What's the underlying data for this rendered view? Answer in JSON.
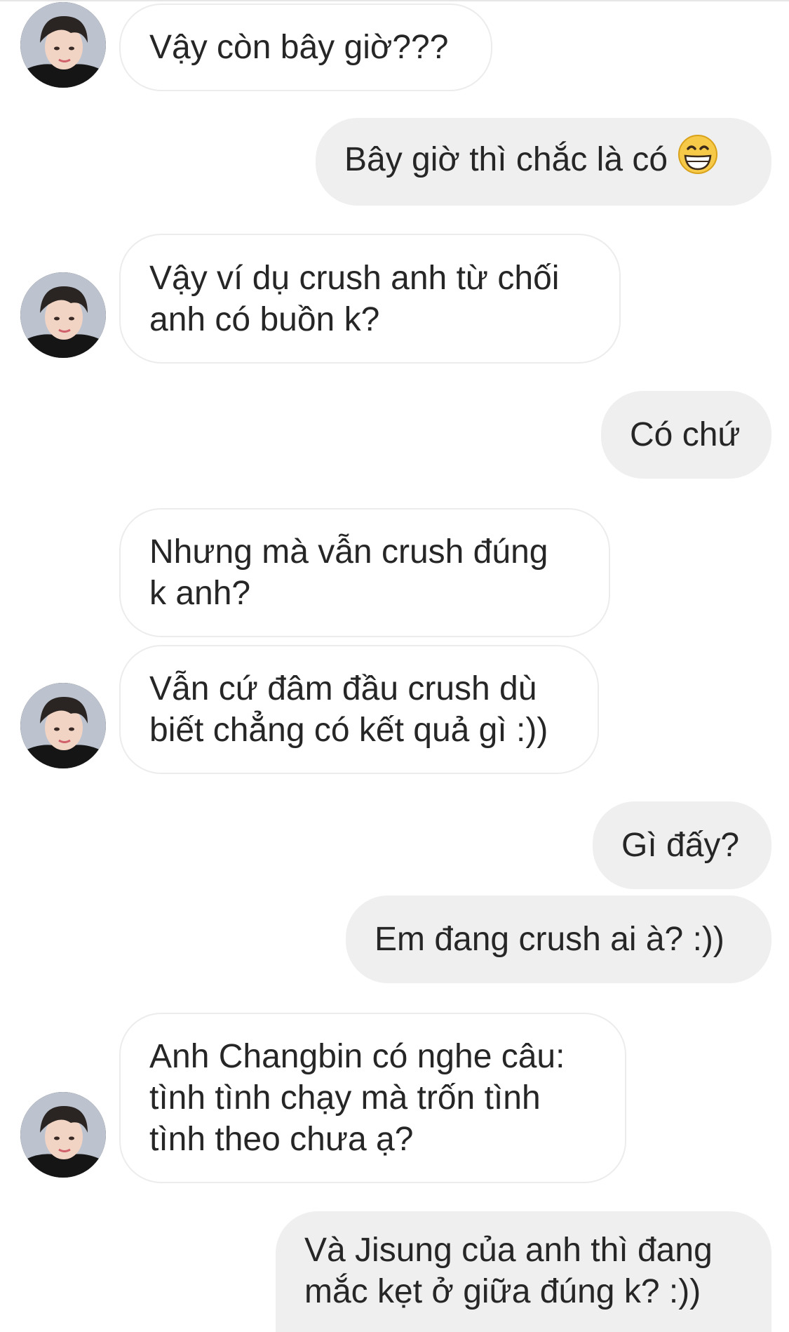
{
  "conversation": {
    "messages": [
      {
        "from": "them",
        "lines": [
          "Vậy còn bây giờ???"
        ]
      },
      {
        "from": "me",
        "lines": [
          "Bây giờ thì chắc là có"
        ],
        "emoji": "grinning-face-emoji"
      },
      {
        "from": "them",
        "lines": [
          "Vậy ví dụ crush anh từ chối",
          "anh có buồn k?"
        ]
      },
      {
        "from": "me",
        "lines": [
          "Có chứ"
        ]
      },
      {
        "from": "them",
        "lines": [
          "Nhưng mà vẫn crush đúng",
          "k anh?"
        ]
      },
      {
        "from": "them",
        "lines": [
          "Vẫn cứ đâm đầu crush dù",
          "biết chẳng có kết quả gì :))"
        ]
      },
      {
        "from": "me",
        "lines": [
          "Gì đấy?"
        ]
      },
      {
        "from": "me",
        "lines": [
          "Em đang crush ai à? :))"
        ]
      },
      {
        "from": "them",
        "lines": [
          "Anh Changbin có nghe câu:",
          "tình tình chạy mà trốn tình",
          "tình theo chưa ạ?"
        ]
      },
      {
        "from": "me",
        "lines": [
          "Và Jisung của anh thì đang",
          "mắc kẹt ở giữa đúng k? :))"
        ]
      }
    ]
  },
  "colors": {
    "incoming_bubble_bg": "#ffffff",
    "incoming_bubble_border": "#ececec",
    "outgoing_bubble_bg": "#efefef",
    "text": "#262626",
    "emoji_face": "#f7c948"
  },
  "icons": {
    "avatar": "profile-photo",
    "emoji": "grinning-face-emoji"
  }
}
